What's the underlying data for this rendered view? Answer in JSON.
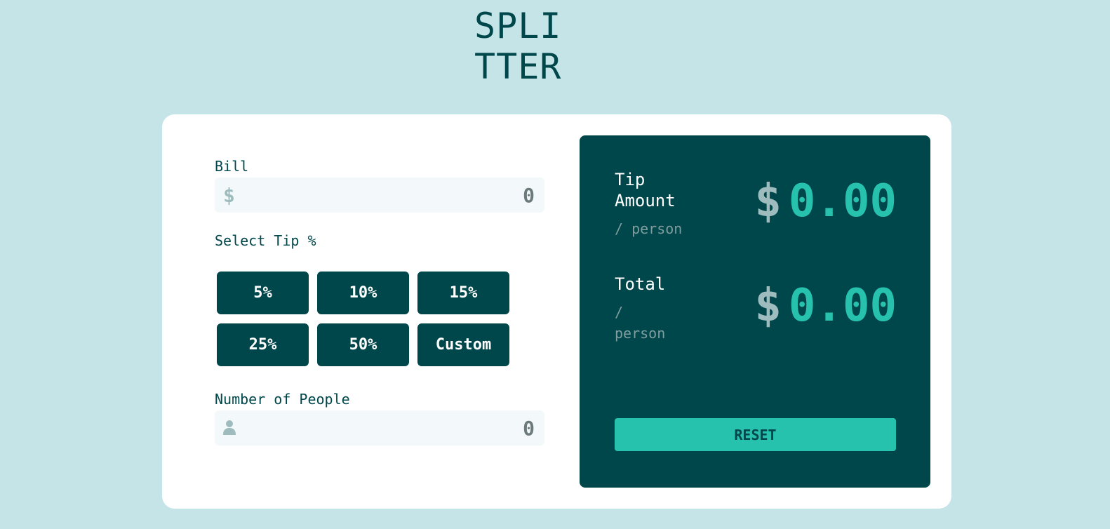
{
  "app": {
    "logo_line1": "SPLI",
    "logo_line2": "TTER"
  },
  "bill": {
    "label": "Bill",
    "currency_symbol": "$",
    "placeholder": "0"
  },
  "tip": {
    "label": "Select Tip %",
    "options": [
      "5%",
      "10%",
      "15%",
      "25%",
      "50%",
      "Custom"
    ]
  },
  "people": {
    "label": "Number of People",
    "icon": "person-icon",
    "placeholder": "0"
  },
  "results": {
    "tip_amount": {
      "title": "Tip Amount",
      "sub": "/ person",
      "currency": "$",
      "value": "0.00"
    },
    "total": {
      "title": "Total",
      "sub_line1": "/",
      "sub_line2": "person",
      "currency": "$",
      "value": "0.00"
    },
    "reset_label": "RESET"
  },
  "colors": {
    "background": "#c5e4e7",
    "dark_cyan": "#00474b",
    "strong_cyan": "#26c2ae",
    "grayish_cyan": "#9ebbbd",
    "input_bg": "#f3f9fa"
  }
}
